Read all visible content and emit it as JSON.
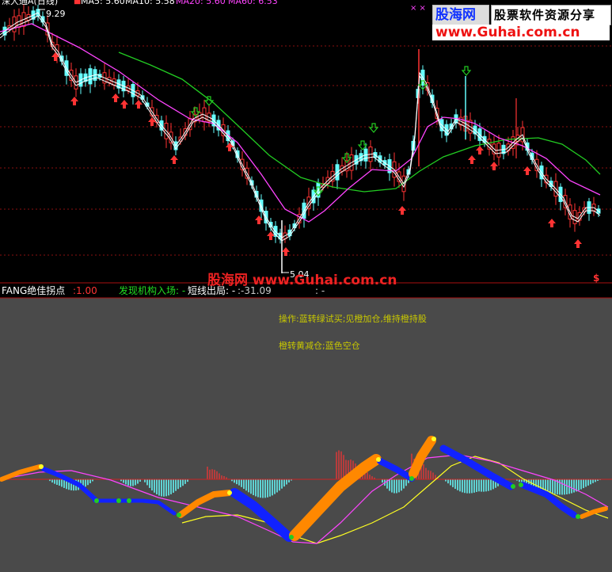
{
  "window": {
    "title": "深大通A(日线)"
  },
  "upper_panel": {
    "ma_labels": [
      {
        "text": "MA5: 5.60",
        "color": "#ffffff"
      },
      {
        "text": "MA10: 5.58",
        "color": "#ffffff"
      },
      {
        "text": "MA20: 5.60",
        "color": "#ff44ff"
      },
      {
        "text": "MA60: 6.53",
        "color": "#ff44ff"
      }
    ],
    "price_high": "9.29",
    "price_low": "5.04",
    "markers": "× ×",
    "currency_symbol": "$",
    "watermark_center": "股海网 www.Guhai.com.cn",
    "logo": {
      "brand": "股海网",
      "slogan": "股票软件资源分享",
      "url": "www.Guhai.com.cn"
    }
  },
  "indicator_header": {
    "name": "FANG绝佳拐点",
    "param": ":1.00",
    "item1": "发现机构入场: -",
    "item2_label": "短线出局: -",
    "item2_value": ":-31.09",
    "item3": ": -"
  },
  "lower_panel": {
    "note1": "操作:蓝转绿试买;见橙加仓,维持橙持股",
    "note2": "橙转黄减仓;蓝色空仓"
  },
  "colors": {
    "up": "#ff3333",
    "down": "#66ffff",
    "ma_white": "#ffffff",
    "ma_pink": "#ff44ff",
    "ma_green": "#22cc22",
    "zero_line": "#cc2222",
    "orange": "#ff8800",
    "blue": "#1122ff",
    "yellow": "#ffff22",
    "lower_bg": "#4a4a4a",
    "note_text": "#c8c800"
  }
}
